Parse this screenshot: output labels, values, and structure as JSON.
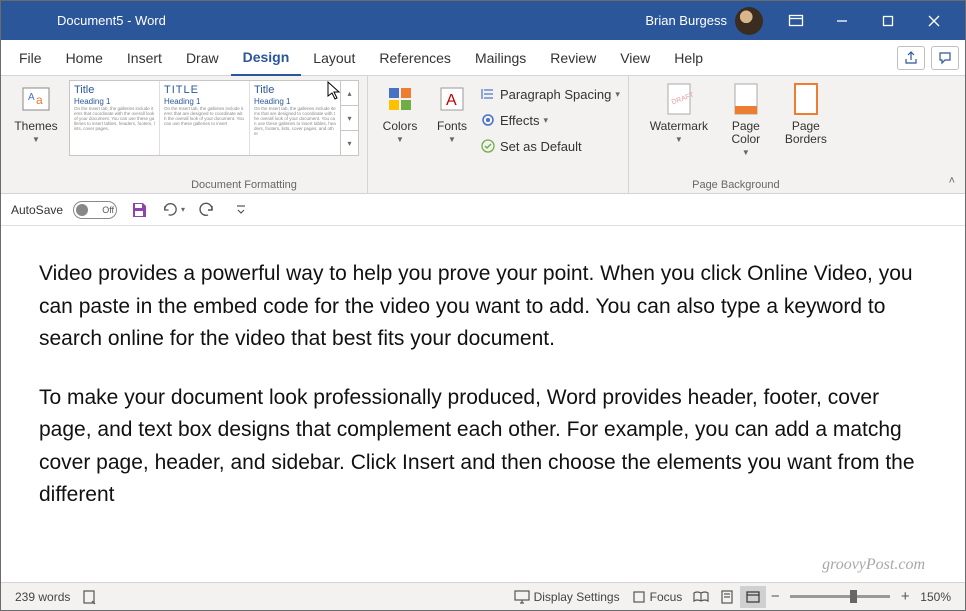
{
  "titlebar": {
    "document": "Document5",
    "app": "Word",
    "full": "Document5  -  Word",
    "user": "Brian Burgess"
  },
  "menu": {
    "items": [
      "File",
      "Home",
      "Insert",
      "Draw",
      "Design",
      "Layout",
      "References",
      "Mailings",
      "Review",
      "View",
      "Help"
    ],
    "active": "Design"
  },
  "ribbon": {
    "themes": "Themes",
    "colors": "Colors",
    "fonts": "Fonts",
    "paragraph_spacing": "Paragraph Spacing",
    "effects": "Effects",
    "set_default": "Set as Default",
    "watermark": "Watermark",
    "page_color": "Page Color",
    "page_borders": "Page Borders",
    "group_doc_formatting": "Document Formatting",
    "group_page_bg": "Page Background",
    "gallery": [
      {
        "title": "Title",
        "heading": "Heading 1",
        "sample": "On the Insert tab, the galleries include items that coordinate with the overall look of your document. You can use these galleries to insert tables, headers, footers, lists, cover pages,"
      },
      {
        "title": "TITLE",
        "heading": "Heading 1",
        "sample": "On the Insert tab, the galleries include items that are designed to coordinate with the overall look of your document. You can use these galleries to insert"
      },
      {
        "title": "Title",
        "heading": "Heading 1",
        "sample": "On the Insert tab, the galleries include items that are designed to coordinate with the overall look of your document. You can use these galleries to insert tables, headers, footers, lists, cover pages, and other"
      }
    ]
  },
  "qat": {
    "autosave": "AutoSave",
    "autosave_state": "Off"
  },
  "doc": {
    "p1": "Video provides a powerful way to help you prove your point. When you click Online Video, you can paste in the embed code for the video you want to add. You can also type a keyword to search online for the video that best fits your document.",
    "p2": "To make your document look professionally produced, Word provides header, footer, cover page, and text box designs that complement each other. For example, you can add a matchg cover page, header, and sidebar. Click Insert and then choose the elements you want from the different"
  },
  "status": {
    "words": "239 words",
    "display_settings": "Display Settings",
    "focus": "Focus",
    "zoom": "150%"
  },
  "watermark": "groovyPost.com"
}
